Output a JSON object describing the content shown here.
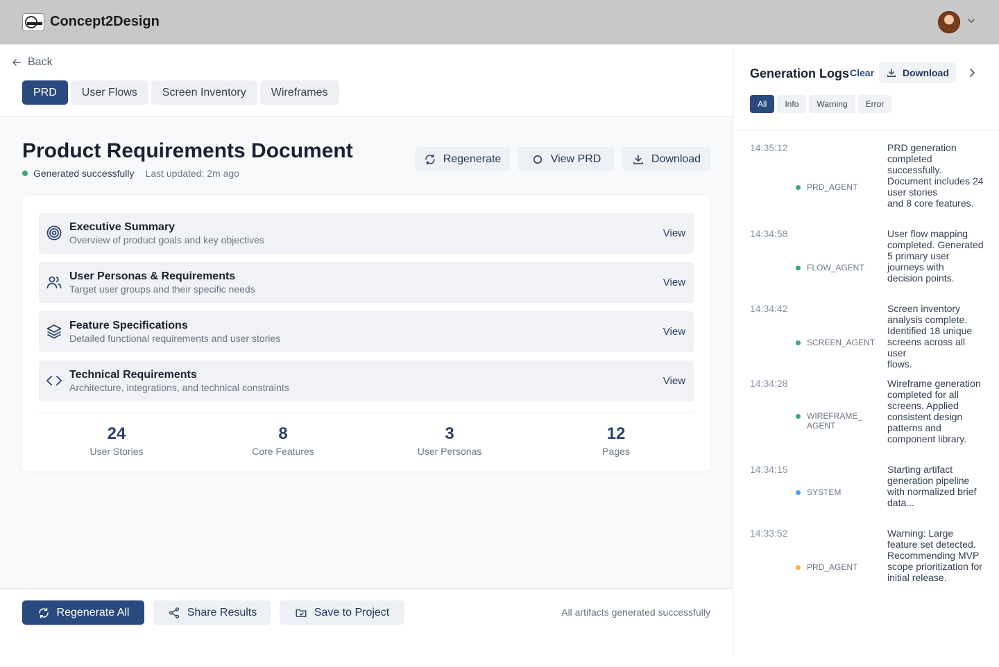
{
  "app": {
    "brand": "Concept2Design"
  },
  "nav": {
    "back_label": "Back",
    "tabs": [
      {
        "label": "PRD",
        "active": true
      },
      {
        "label": "User Flows",
        "active": false
      },
      {
        "label": "Screen Inventory",
        "active": false
      },
      {
        "label": "Wireframes",
        "active": false
      }
    ]
  },
  "doc": {
    "title": "Product Requirements Document",
    "status": "Generated successfully",
    "last_updated": "Last updated: 2m ago",
    "actions": {
      "regenerate": "Regenerate",
      "view": "View PRD",
      "download": "Download"
    }
  },
  "sections": [
    {
      "icon": "target-icon",
      "title": "Executive Summary",
      "desc": "Overview of product goals and key objectives",
      "action": "View"
    },
    {
      "icon": "users-icon",
      "title": "User Personas & Requirements",
      "desc": "Target user groups and their specific needs",
      "action": "View"
    },
    {
      "icon": "layers-icon",
      "title": "Feature Specifications",
      "desc": "Detailed functional requirements and user stories",
      "action": "View"
    },
    {
      "icon": "code-icon",
      "title": "Technical Requirements",
      "desc": "Architecture, integrations, and technical constraints",
      "action": "View"
    }
  ],
  "stats": [
    {
      "value": "24",
      "label": "User Stories"
    },
    {
      "value": "8",
      "label": "Core Features"
    },
    {
      "value": "3",
      "label": "User Personas"
    },
    {
      "value": "12",
      "label": "Pages"
    }
  ],
  "footer": {
    "regenerate_all": "Regenerate All",
    "share": "Share Results",
    "save": "Save to Project",
    "status": "All artifacts generated successfully"
  },
  "logs_panel": {
    "title": "Generation Logs",
    "clear": "Clear",
    "download": "Download",
    "filters": [
      {
        "label": "All",
        "active": true
      },
      {
        "label": "Info",
        "active": false
      },
      {
        "label": "Warning",
        "active": false
      },
      {
        "label": "Error",
        "active": false
      }
    ],
    "entries": [
      {
        "time": "14:35:12",
        "agent": "PRD_AGENT",
        "level_color": "#3aa872",
        "message": "PRD generation completed successfully. Document includes 24 user stories\nand 8 core features."
      },
      {
        "time": "14:34:58",
        "agent": "FLOW_AGENT",
        "level_color": "#3aa872",
        "message": "User flow mapping completed. Generated 5 primary user journeys with\ndecision points."
      },
      {
        "time": "14:34:42",
        "agent": "SCREEN_AGENT",
        "level_color": "#3aa872",
        "message": "Screen inventory analysis complete. Identified 18 unique screens across all user\nflows."
      },
      {
        "time": "14:34:28",
        "agent": "WIREFRAME_AGENT",
        "level_color": "#3aa872",
        "message": "Wireframe generation completed for all screens. Applied consistent design patterns and component library."
      },
      {
        "time": "14:34:15",
        "agent": "SYSTEM",
        "level_color": "#4aa3e0",
        "message": "Starting artifact generation pipeline with normalized brief data..."
      },
      {
        "time": "14:33:52",
        "agent": "PRD_AGENT",
        "level_color": "#f2b73f",
        "message": "Warning: Large feature set detected. Recommending MVP scope prioritization for initial release."
      }
    ]
  }
}
